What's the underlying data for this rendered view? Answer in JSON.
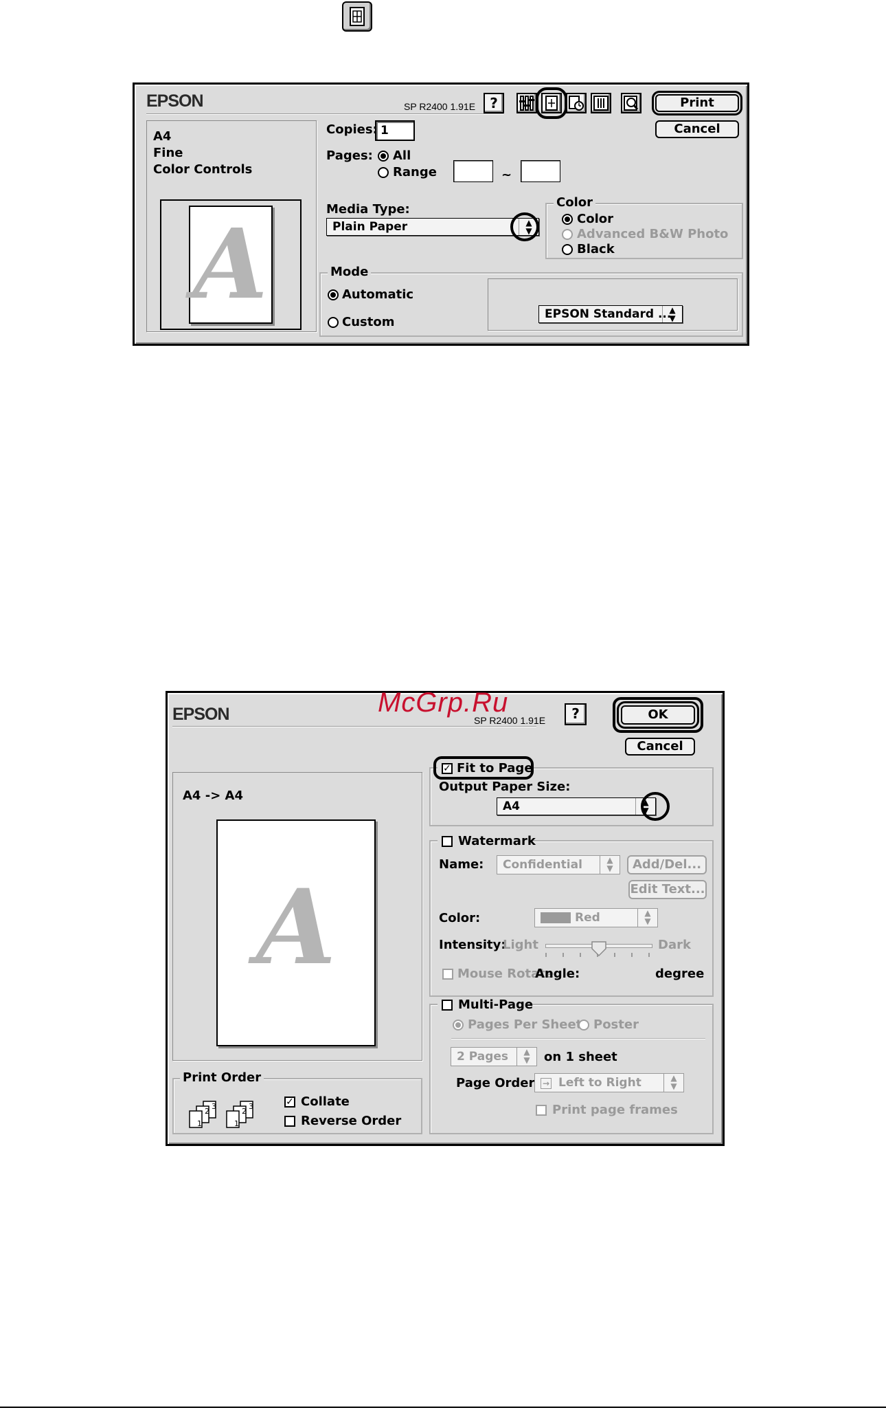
{
  "top_icon": {
    "name": "layout-icon"
  },
  "watermark_text": "McGrp.Ru",
  "dialog1": {
    "brand": "EPSON",
    "version": "SP R2400 1.91E",
    "toolbar": [
      "help-icon",
      "custom-settings-icon",
      "layout-icon",
      "print-time-icon",
      "background-icon",
      "preview-icon"
    ],
    "help_label": "?",
    "print_label": "Print",
    "cancel_label": "Cancel",
    "summary": [
      "A4",
      "Fine",
      "Color Controls"
    ],
    "preview_letter": "A",
    "copies_label": "Copies:",
    "copies_value": "1",
    "pages_label": "Pages:",
    "pages_all": "All",
    "pages_range": "Range",
    "range_sep": "~",
    "media_label": "Media Type:",
    "media_value": "Plain Paper",
    "color_group": "Color",
    "color_opts": [
      "Color",
      "Advanced B&W Photo",
      "Black"
    ],
    "mode_group": "Mode",
    "mode_auto": "Automatic",
    "mode_custom": "Custom",
    "mode_popup": "EPSON Standard ..."
  },
  "dialog2": {
    "brand": "EPSON",
    "version": "SP R2400 1.91E",
    "help_label": "?",
    "ok_label": "OK",
    "cancel_label": "Cancel",
    "scale_text": "A4 -> A4",
    "preview_letter": "A",
    "fit_label": "Fit to Page",
    "output_label": "Output Paper Size:",
    "output_value": "A4",
    "watermark_label": "Watermark",
    "name_label": "Name:",
    "name_value": "Confidential",
    "add_del_label": "Add/Del...",
    "edit_text_label": "Edit Text...",
    "color_label": "Color:",
    "color_value": "Red",
    "intensity_label": "Intensity:",
    "light_label": "Light",
    "dark_label": "Dark",
    "intensity_level": 0.5,
    "mouse_rotate_label": "Mouse Rotate",
    "angle_label": "Angle:",
    "degree_label": "degree",
    "multipage_label": "Multi-Page",
    "pps_label": "Pages Per Sheet",
    "poster_label": "Poster",
    "pages_value": "2 Pages",
    "on_sheet": "on 1 sheet",
    "page_order_label": "Page Order:",
    "page_order_value": "Left to Right",
    "frames_label": "Print page frames",
    "print_order_label": "Print Order",
    "collate_label": "Collate",
    "reverse_label": "Reverse Order"
  }
}
